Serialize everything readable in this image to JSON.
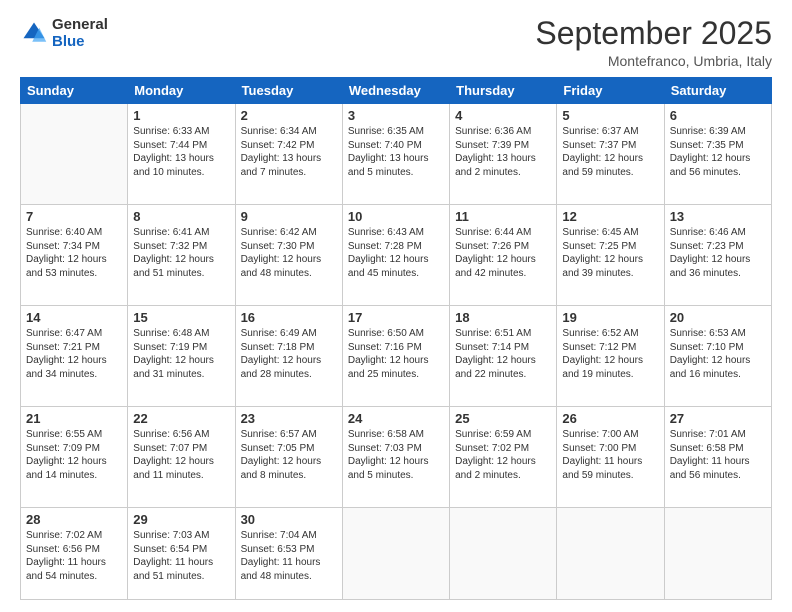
{
  "logo": {
    "general": "General",
    "blue": "Blue"
  },
  "header": {
    "month": "September 2025",
    "location": "Montefranco, Umbria, Italy"
  },
  "weekdays": [
    "Sunday",
    "Monday",
    "Tuesday",
    "Wednesday",
    "Thursday",
    "Friday",
    "Saturday"
  ],
  "weeks": [
    [
      {
        "day": null,
        "info": null
      },
      {
        "day": "1",
        "info": "Sunrise: 6:33 AM\nSunset: 7:44 PM\nDaylight: 13 hours\nand 10 minutes."
      },
      {
        "day": "2",
        "info": "Sunrise: 6:34 AM\nSunset: 7:42 PM\nDaylight: 13 hours\nand 7 minutes."
      },
      {
        "day": "3",
        "info": "Sunrise: 6:35 AM\nSunset: 7:40 PM\nDaylight: 13 hours\nand 5 minutes."
      },
      {
        "day": "4",
        "info": "Sunrise: 6:36 AM\nSunset: 7:39 PM\nDaylight: 13 hours\nand 2 minutes."
      },
      {
        "day": "5",
        "info": "Sunrise: 6:37 AM\nSunset: 7:37 PM\nDaylight: 12 hours\nand 59 minutes."
      },
      {
        "day": "6",
        "info": "Sunrise: 6:39 AM\nSunset: 7:35 PM\nDaylight: 12 hours\nand 56 minutes."
      }
    ],
    [
      {
        "day": "7",
        "info": "Sunrise: 6:40 AM\nSunset: 7:34 PM\nDaylight: 12 hours\nand 53 minutes."
      },
      {
        "day": "8",
        "info": "Sunrise: 6:41 AM\nSunset: 7:32 PM\nDaylight: 12 hours\nand 51 minutes."
      },
      {
        "day": "9",
        "info": "Sunrise: 6:42 AM\nSunset: 7:30 PM\nDaylight: 12 hours\nand 48 minutes."
      },
      {
        "day": "10",
        "info": "Sunrise: 6:43 AM\nSunset: 7:28 PM\nDaylight: 12 hours\nand 45 minutes."
      },
      {
        "day": "11",
        "info": "Sunrise: 6:44 AM\nSunset: 7:26 PM\nDaylight: 12 hours\nand 42 minutes."
      },
      {
        "day": "12",
        "info": "Sunrise: 6:45 AM\nSunset: 7:25 PM\nDaylight: 12 hours\nand 39 minutes."
      },
      {
        "day": "13",
        "info": "Sunrise: 6:46 AM\nSunset: 7:23 PM\nDaylight: 12 hours\nand 36 minutes."
      }
    ],
    [
      {
        "day": "14",
        "info": "Sunrise: 6:47 AM\nSunset: 7:21 PM\nDaylight: 12 hours\nand 34 minutes."
      },
      {
        "day": "15",
        "info": "Sunrise: 6:48 AM\nSunset: 7:19 PM\nDaylight: 12 hours\nand 31 minutes."
      },
      {
        "day": "16",
        "info": "Sunrise: 6:49 AM\nSunset: 7:18 PM\nDaylight: 12 hours\nand 28 minutes."
      },
      {
        "day": "17",
        "info": "Sunrise: 6:50 AM\nSunset: 7:16 PM\nDaylight: 12 hours\nand 25 minutes."
      },
      {
        "day": "18",
        "info": "Sunrise: 6:51 AM\nSunset: 7:14 PM\nDaylight: 12 hours\nand 22 minutes."
      },
      {
        "day": "19",
        "info": "Sunrise: 6:52 AM\nSunset: 7:12 PM\nDaylight: 12 hours\nand 19 minutes."
      },
      {
        "day": "20",
        "info": "Sunrise: 6:53 AM\nSunset: 7:10 PM\nDaylight: 12 hours\nand 16 minutes."
      }
    ],
    [
      {
        "day": "21",
        "info": "Sunrise: 6:55 AM\nSunset: 7:09 PM\nDaylight: 12 hours\nand 14 minutes."
      },
      {
        "day": "22",
        "info": "Sunrise: 6:56 AM\nSunset: 7:07 PM\nDaylight: 12 hours\nand 11 minutes."
      },
      {
        "day": "23",
        "info": "Sunrise: 6:57 AM\nSunset: 7:05 PM\nDaylight: 12 hours\nand 8 minutes."
      },
      {
        "day": "24",
        "info": "Sunrise: 6:58 AM\nSunset: 7:03 PM\nDaylight: 12 hours\nand 5 minutes."
      },
      {
        "day": "25",
        "info": "Sunrise: 6:59 AM\nSunset: 7:02 PM\nDaylight: 12 hours\nand 2 minutes."
      },
      {
        "day": "26",
        "info": "Sunrise: 7:00 AM\nSunset: 7:00 PM\nDaylight: 11 hours\nand 59 minutes."
      },
      {
        "day": "27",
        "info": "Sunrise: 7:01 AM\nSunset: 6:58 PM\nDaylight: 11 hours\nand 56 minutes."
      }
    ],
    [
      {
        "day": "28",
        "info": "Sunrise: 7:02 AM\nSunset: 6:56 PM\nDaylight: 11 hours\nand 54 minutes."
      },
      {
        "day": "29",
        "info": "Sunrise: 7:03 AM\nSunset: 6:54 PM\nDaylight: 11 hours\nand 51 minutes."
      },
      {
        "day": "30",
        "info": "Sunrise: 7:04 AM\nSunset: 6:53 PM\nDaylight: 11 hours\nand 48 minutes."
      },
      {
        "day": null,
        "info": null
      },
      {
        "day": null,
        "info": null
      },
      {
        "day": null,
        "info": null
      },
      {
        "day": null,
        "info": null
      }
    ]
  ]
}
